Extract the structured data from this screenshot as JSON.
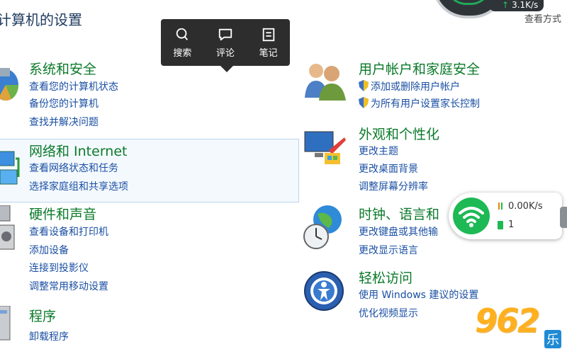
{
  "header": {
    "title": "计算机的设置",
    "view_by": "查看方式",
    "net_speed_top": "3.1K/s"
  },
  "toolbar": {
    "search_label": "搜索",
    "comment_label": "评论",
    "note_label": "笔记"
  },
  "left": [
    {
      "title": "系统和安全",
      "icon": "system-security-icon",
      "links": [
        "查看您的计算机状态",
        "备份您的计算机",
        "查找并解决问题"
      ]
    },
    {
      "title": "网络和 Internet",
      "icon": "network-icon",
      "links": [
        "查看网络状态和任务",
        "选择家庭组和共享选项"
      ]
    },
    {
      "title": "硬件和声音",
      "icon": "hardware-sound-icon",
      "links": [
        "查看设备和打印机",
        "添加设备",
        "连接到投影仪",
        "调整常用移动设置"
      ]
    },
    {
      "title": "程序",
      "icon": "programs-icon",
      "links": [
        "卸载程序"
      ]
    }
  ],
  "right": [
    {
      "title": "用户帐户和家庭安全",
      "icon": "user-accounts-icon",
      "links": [
        "添加或删除用户帐户",
        "为所有用户设置家长控制"
      ]
    },
    {
      "title": "外观和个性化",
      "icon": "appearance-icon",
      "links": [
        "更改主题",
        "更改桌面背景",
        "调整屏幕分辨率"
      ]
    },
    {
      "title": "时钟、语言和",
      "icon": "clock-language-icon",
      "links": [
        "更改键盘或其他输",
        "更改显示语言"
      ]
    },
    {
      "title": "轻松访问",
      "icon": "ease-of-access-icon",
      "links": [
        "使用 Windows 建议的设置",
        "优化视频显示"
      ]
    }
  ],
  "wifi_widget": {
    "speed": "0.00K/s",
    "device_count": "1",
    "accent": "#1db954"
  },
  "watermark": {
    "text": "962",
    "suffix": "乐"
  },
  "colors": {
    "category_title": "#0b7a2a",
    "link": "#1a4fa3"
  }
}
